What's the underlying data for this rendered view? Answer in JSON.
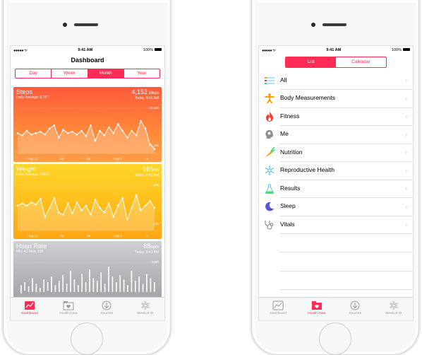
{
  "left_phone": {
    "status": {
      "signal": "●●●●● ᯤ",
      "time": "9:41 AM",
      "battery": "100%"
    },
    "title": "Dashboard",
    "segments": [
      "Day",
      "Week",
      "Month",
      "Year"
    ],
    "active_segment": 2,
    "cards": {
      "steps": {
        "title": "Steps",
        "value": "4,152",
        "unit": " steps",
        "sub_left": "Daily Average: 8,757",
        "sub_right": "Today, 9:41 AM",
        "max_label": "13,648",
        "last_label": "4,152",
        "x_labels": [
          "Aug 12",
          "19",
          "26",
          "Sep 2",
          "9"
        ],
        "values": [
          0.45,
          0.4,
          0.5,
          0.42,
          0.45,
          0.48,
          0.42,
          0.55,
          0.62,
          0.35,
          0.52,
          0.45,
          0.48,
          0.42,
          0.5,
          0.38,
          0.62,
          0.28,
          0.5,
          0.4,
          0.58,
          0.45,
          0.65,
          0.5,
          0.35,
          0.5,
          0.4,
          0.72,
          0.55,
          0.2,
          0.1
        ]
      },
      "weight": {
        "title": "Weight",
        "value": "165",
        "unit": "lbs",
        "sub_left": "Daily Average: 166.5",
        "sub_right": "Today, 9:41 AM",
        "max_label": "169",
        "last_label": "165",
        "x_labels": [
          "Aug 12",
          "19",
          "26",
          "Sep 2",
          "9"
        ],
        "values": [
          0.55,
          0.6,
          0.55,
          0.62,
          0.58,
          0.7,
          0.3,
          0.5,
          0.72,
          0.4,
          0.35,
          0.6,
          0.38,
          0.62,
          0.45,
          0.55,
          0.35,
          0.68,
          0.5,
          0.4,
          0.6,
          0.3,
          0.55,
          0.72,
          0.25,
          0.5,
          0.78,
          0.45,
          0.55,
          0.65,
          0.5
        ]
      },
      "heart": {
        "title": "Heart Rate",
        "value": "88",
        "unit": "bpm",
        "sub_left": "Min: 41 Max: 138",
        "sub_right": "Today, 9:41 AM",
        "max_label": "106h"
      }
    },
    "tabs": [
      "Dashboard",
      "Health Data",
      "Sources",
      "Medical ID"
    ],
    "active_tab": 0
  },
  "right_phone": {
    "status": {
      "signal": "●●●●● ᯤ",
      "time": "9:41 AM",
      "battery": "100%"
    },
    "segments": [
      "List",
      "Calendar"
    ],
    "active_segment": 0,
    "items": [
      {
        "label": "All",
        "icon": "list-icon"
      },
      {
        "label": "Body Measurements",
        "icon": "person-icon"
      },
      {
        "label": "Fitness",
        "icon": "flame-icon"
      },
      {
        "label": "Me",
        "icon": "head-icon"
      },
      {
        "label": "Nutrition",
        "icon": "carrot-icon"
      },
      {
        "label": "Reproductive Health",
        "icon": "snowflake-icon"
      },
      {
        "label": "Results",
        "icon": "flask-icon"
      },
      {
        "label": "Sleep",
        "icon": "moon-icon"
      },
      {
        "label": "Vitals",
        "icon": "stethoscope-icon"
      }
    ],
    "tabs": [
      "Dashboard",
      "Health Data",
      "Sources",
      "Medical ID"
    ],
    "active_tab": 1
  },
  "colors": {
    "accent": "#ff2d55",
    "steps_top": "#ff6a3d",
    "steps_bottom": "#ff9a3c",
    "weight_top": "#ffd21f",
    "weight_bottom": "#ffa500",
    "heart_top": "#c8c8cc",
    "heart_bottom": "#9d9da2"
  }
}
